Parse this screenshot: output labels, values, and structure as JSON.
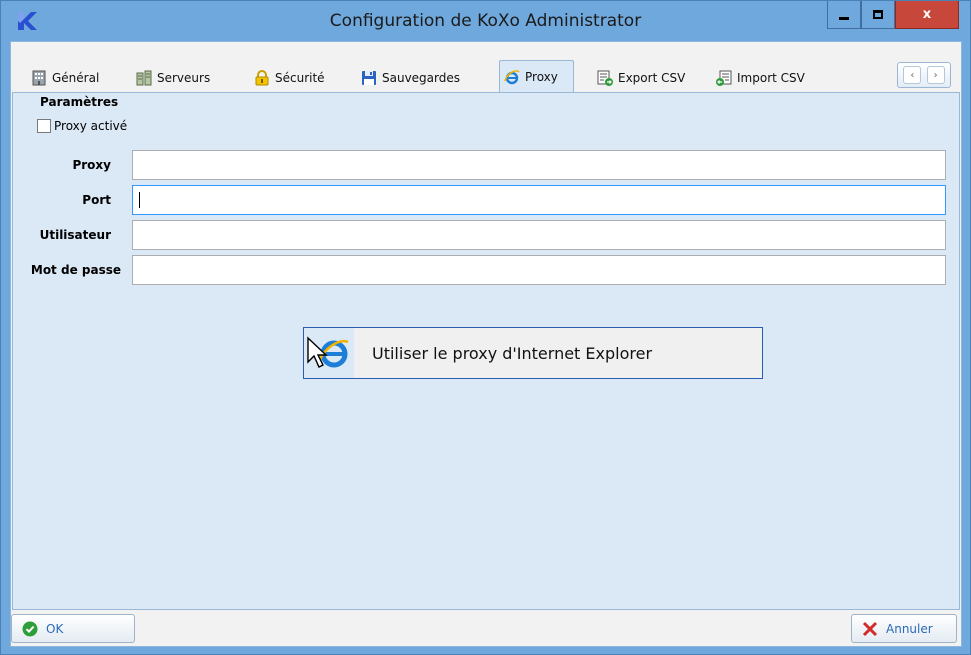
{
  "window": {
    "title": "Configuration de KoXo Administrator",
    "buttons": {
      "minimize": "_",
      "maximize": "□",
      "close": "x"
    }
  },
  "tabs": [
    {
      "label": "Général",
      "icon": "building-icon"
    },
    {
      "label": "Serveurs",
      "icon": "servers-icon"
    },
    {
      "label": "Sécurité",
      "icon": "lock-icon"
    },
    {
      "label": "Sauvegardes",
      "icon": "floppy-icon"
    },
    {
      "label": "Proxy",
      "icon": "ie-icon",
      "active": true
    },
    {
      "label": "Export CSV",
      "icon": "export-csv-icon"
    },
    {
      "label": "Import CSV",
      "icon": "import-csv-icon"
    }
  ],
  "tab_scroll": {
    "left": "‹",
    "right": "›"
  },
  "proxy_panel": {
    "group_title": "Paramètres",
    "proxy_enabled": {
      "label": "Proxy activé",
      "checked": false
    },
    "fields": {
      "proxy": {
        "label": "Proxy",
        "value": ""
      },
      "port": {
        "label": "Port",
        "value": ""
      },
      "user": {
        "label": "Utilisateur",
        "value": ""
      },
      "password": {
        "label": "Mot de passe",
        "value": ""
      }
    },
    "ie_button": {
      "label": "Utiliser le proxy d'Internet Explorer",
      "icon": "ie-icon"
    }
  },
  "footer": {
    "ok_label": "OK",
    "cancel_label": "Annuler"
  },
  "colors": {
    "window_frame": "#6fa8dc",
    "close_button": "#c7483a",
    "panel_bg": "#dbe8f6",
    "ok_green": "#2e9e3a",
    "cancel_red": "#d22b2b"
  }
}
